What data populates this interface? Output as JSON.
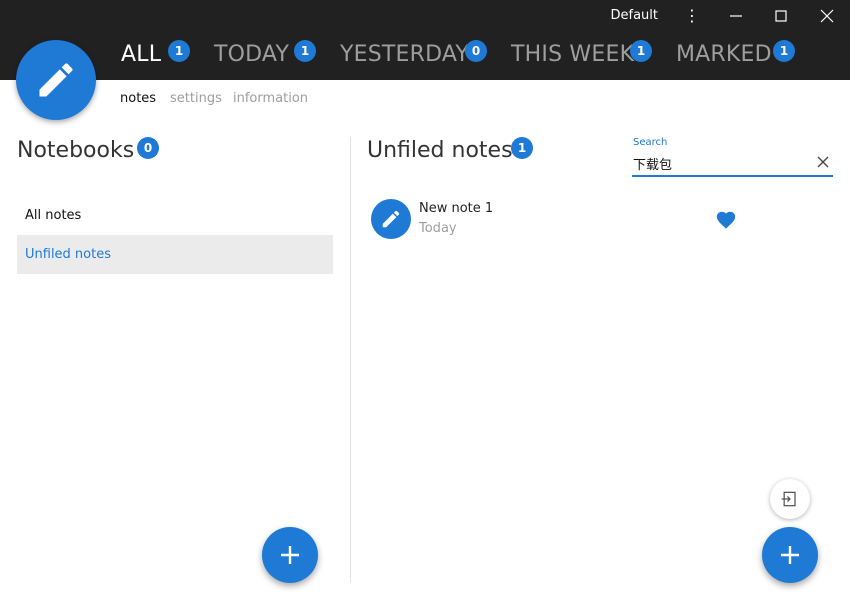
{
  "window": {
    "profile_label": "Default",
    "menu_glyph": "⋮"
  },
  "tabs": [
    {
      "label": "ALL",
      "count": "1"
    },
    {
      "label": "TODAY",
      "count": "1"
    },
    {
      "label": "YESTERDAY",
      "count": "0"
    },
    {
      "label": "THIS WEEK",
      "count": "1"
    },
    {
      "label": "MARKED",
      "count": "1"
    }
  ],
  "subtabs": [
    {
      "label": "notes"
    },
    {
      "label": "settings"
    },
    {
      "label": "information"
    }
  ],
  "notebooks": {
    "title": "Notebooks",
    "count": "0",
    "items": [
      {
        "label": "All notes"
      },
      {
        "label": "Unfiled notes"
      }
    ]
  },
  "notes_panel": {
    "title": "Unfiled notes",
    "count": "1",
    "notes": [
      {
        "title": "New note 1",
        "date": "Today"
      }
    ]
  },
  "search": {
    "label": "Search",
    "value": "下载包"
  },
  "icons": {
    "logo": "pencil-icon",
    "note": "pencil-icon",
    "marked": "heart-icon",
    "add": "plus-icon",
    "import": "import-icon"
  },
  "colors": {
    "accent": "#1e7ad4",
    "topbar": "#212121",
    "selected_row": "#ebebeb"
  }
}
